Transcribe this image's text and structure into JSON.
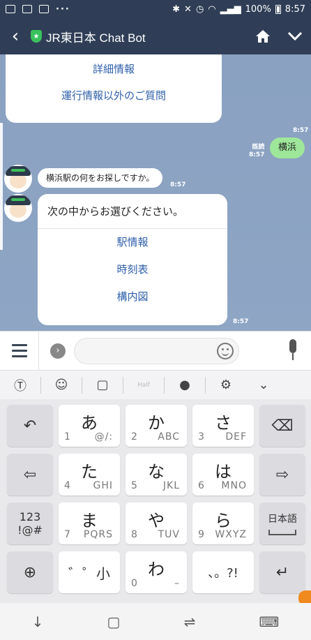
{
  "status": {
    "battery": "100%",
    "time": "8:57",
    "dots": "···"
  },
  "header": {
    "title": "JR東日本 Chat Bot"
  },
  "chat": {
    "top_card_items": [
      "詳細情報",
      "運行情報以外のご質問"
    ],
    "me_read": "既読",
    "me_time": "8:57",
    "me_time_top": "8:57",
    "me_message": "横浜",
    "bot_message": "横浜駅の何をお探しですか。",
    "bot_time": "8:57",
    "choice_title": "次の中からお選びください。",
    "choice_options": [
      "駅情報",
      "時刻表",
      "構内図"
    ],
    "choice_time": "8:57"
  },
  "input": {
    "placeholder": ""
  },
  "kbtool": {
    "half_label": "Half"
  },
  "keyboard": {
    "rows": [
      [
        {
          "kana": "あ",
          "num": "1",
          "sub": "@/:"
        },
        {
          "kana": "か",
          "num": "2",
          "sub": "ABC"
        },
        {
          "kana": "さ",
          "num": "3",
          "sub": "DEF"
        }
      ],
      [
        {
          "kana": "た",
          "num": "4",
          "sub": "GHI"
        },
        {
          "kana": "な",
          "num": "5",
          "sub": "JKL"
        },
        {
          "kana": "は",
          "num": "6",
          "sub": "MNO"
        }
      ],
      [
        {
          "kana": "ま",
          "num": "7",
          "sub": "PQRS"
        },
        {
          "kana": "や",
          "num": "8",
          "sub": "TUV"
        },
        {
          "kana": "ら",
          "num": "9",
          "sub": "WXYZ"
        }
      ]
    ],
    "dakuten": "゛゜小",
    "wa": "わ",
    "wa_num": "0",
    "wa_sub": "–",
    "punct": "、。?!",
    "mode_123": "123\n!@#",
    "mode_123_a": "123",
    "mode_123_b": "!@#",
    "lang_key": "日本語"
  }
}
